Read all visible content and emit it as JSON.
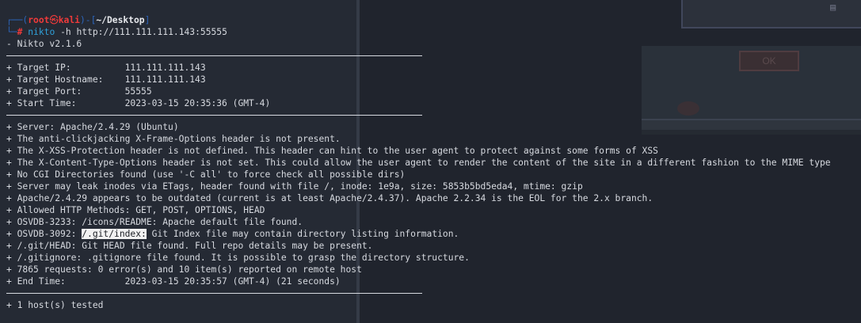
{
  "background_app": {
    "ok_label": "OK"
  },
  "prompt": {
    "frame_open": "┌──(",
    "user": "root",
    "skull": "㉿",
    "host": "kali",
    "frame_mid": ")-[",
    "path": "~/Desktop",
    "frame_close": "]",
    "frame_bottom": "└─",
    "hash": "#",
    "command": "nikto",
    "args": "-h http://111.111.111.143:55555"
  },
  "output": {
    "version": "- Nikto v2.1.6",
    "target_lines": [
      "+ Target IP:          111.111.111.143",
      "+ Target Hostname:    111.111.111.143",
      "+ Target Port:        55555",
      "+ Start Time:         2023-03-15 20:35:36 (GMT-4)"
    ],
    "result_lines": [
      "+ Server: Apache/2.4.29 (Ubuntu)",
      "+ The anti-clickjacking X-Frame-Options header is not present.",
      "+ The X-XSS-Protection header is not defined. This header can hint to the user agent to protect against some forms of XSS",
      "+ The X-Content-Type-Options header is not set. This could allow the user agent to render the content of the site in a different fashion to the MIME type",
      "+ No CGI Directories found (use '-C all' to force check all possible dirs)",
      "+ Server may leak inodes via ETags, header found with file /, inode: 1e9a, size: 5853b5bd5eda4, mtime: gzip",
      "+ Apache/2.4.29 appears to be outdated (current is at least Apache/2.4.37). Apache 2.2.34 is the EOL for the 2.x branch.",
      "+ Allowed HTTP Methods: GET, POST, OPTIONS, HEAD",
      "+ OSVDB-3233: /icons/README: Apache default file found."
    ],
    "git_index": {
      "prefix": "+ OSVDB-3092: ",
      "highlight": "/.git/index:",
      "suffix": " Git Index file may contain directory listing information."
    },
    "result_lines_2": [
      "+ /.git/HEAD: Git HEAD file found. Full repo details may be present.",
      "+ /.gitignore: .gitignore file found. It is possible to grasp the directory structure.",
      "+ 7865 requests: 0 error(s) and 10 item(s) reported on remote host",
      "+ End Time:           2023-03-15 20:35:57 (GMT-4) (21 seconds)"
    ],
    "hosts_tested": "+ 1 host(s) tested"
  }
}
